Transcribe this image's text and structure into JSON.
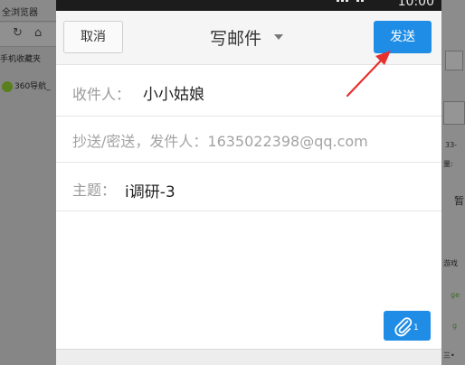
{
  "desktop": {
    "window_title": "全浏览器",
    "toolbar_icons": [
      "refresh-icon",
      "home-icon"
    ],
    "bookmark_label": "手机收藏夹",
    "nav_label": "360导航_",
    "right_fragments": [
      "33-",
      "量:",
      "暂",
      "游戏",
      "ge",
      "g",
      "三•"
    ]
  },
  "status": {
    "clock": "10:00"
  },
  "header": {
    "cancel_label": "取消",
    "title": "写邮件",
    "send_label": "发送"
  },
  "compose": {
    "to_label": "收件人：",
    "to_value": "小小姑娘",
    "cc_text": "抄送/密送，发件人：1635022398@qq.com",
    "subject_label": "主题：",
    "subject_value": "i调研-3"
  },
  "attachment": {
    "count": "1",
    "icon": "paperclip-icon"
  },
  "colors": {
    "accent": "#1f8de5",
    "annotation": "#e8302f"
  }
}
